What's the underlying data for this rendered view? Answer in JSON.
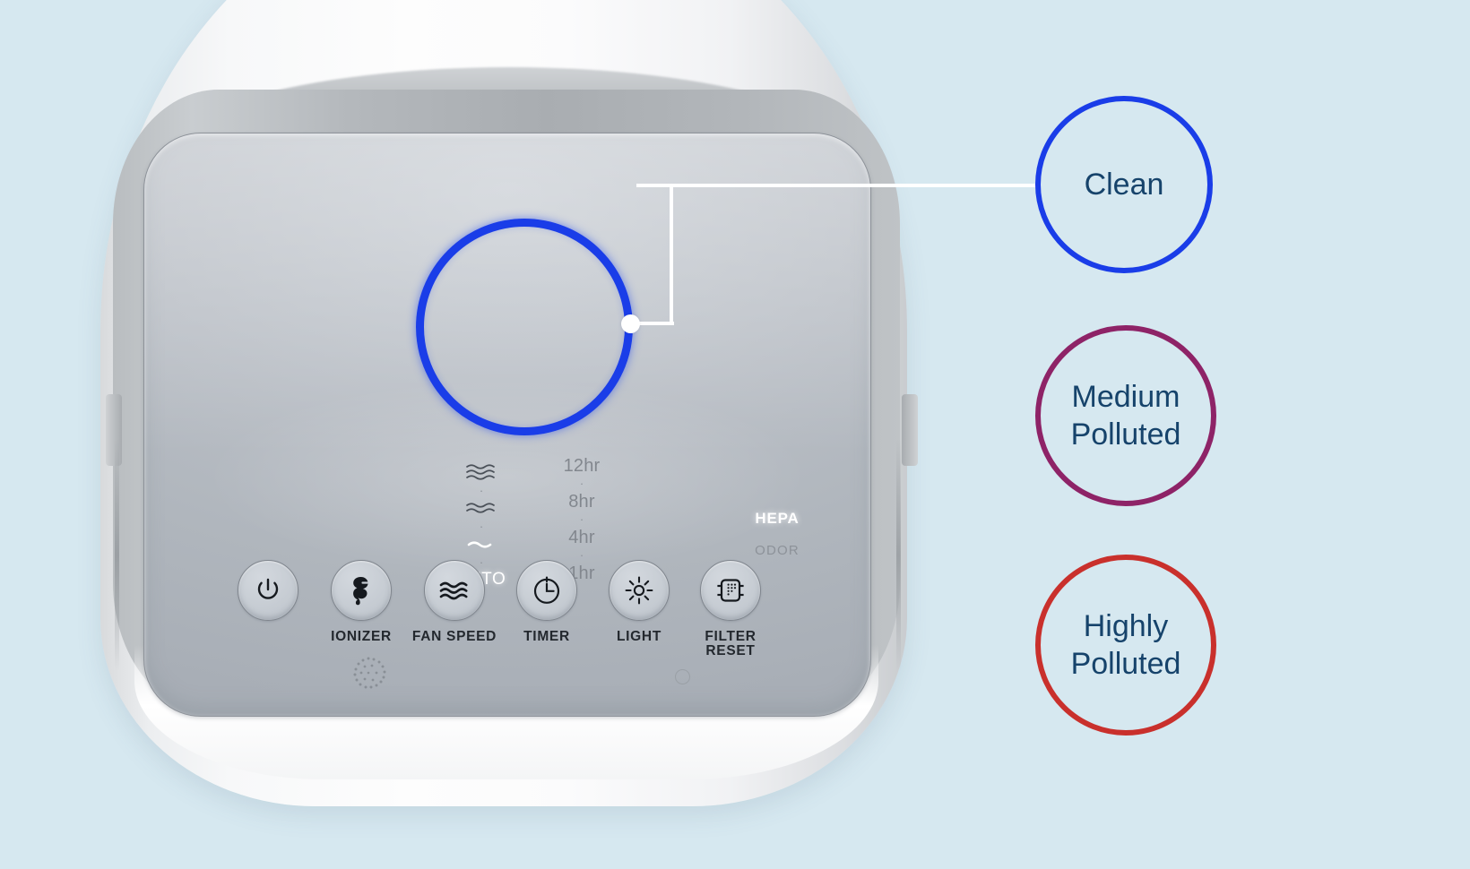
{
  "background_color": "#d6e8f0",
  "device": {
    "name": "air-purifier",
    "panel_label": "control-panel"
  },
  "air_quality_ring": {
    "state": "Clean",
    "color": "#1a3de8"
  },
  "indicators": {
    "ionizer": {
      "icon": "ion-particles-icon",
      "active": false
    },
    "fan_speed": {
      "levels": [
        "high",
        "medium",
        "low"
      ],
      "active_level": "low",
      "auto_label": "AUTO",
      "auto_active": true
    },
    "timer": {
      "steps": [
        "12hr",
        "8hr",
        "4hr",
        "1hr"
      ],
      "active_step": null
    },
    "light": {
      "icon": "light-indicator-circle",
      "active": false
    },
    "filter": {
      "hepa_label": "HEPA",
      "hepa_active": true,
      "odor_label": "ODOR",
      "odor_active": false
    }
  },
  "buttons": [
    {
      "id": "power",
      "label": "",
      "icon": "power-icon"
    },
    {
      "id": "ionizer",
      "label": "IONIZER",
      "icon": "ionizer-icon"
    },
    {
      "id": "fan-speed",
      "label": "FAN SPEED",
      "icon": "fan-speed-waves-icon"
    },
    {
      "id": "timer",
      "label": "TIMER",
      "icon": "clock-icon"
    },
    {
      "id": "light",
      "label": "LIGHT",
      "icon": "sun-icon"
    },
    {
      "id": "filter-reset",
      "label": "FILTER\nRESET",
      "icon": "filter-icon"
    }
  ],
  "callouts": [
    {
      "id": "clean",
      "text": "Clean",
      "color": "#1a3de8"
    },
    {
      "id": "medium-polluted",
      "text": "Medium\nPolluted",
      "color": "#8e2367"
    },
    {
      "id": "highly-polluted",
      "text": "Highly\nPolluted",
      "color": "#c9302c"
    }
  ]
}
